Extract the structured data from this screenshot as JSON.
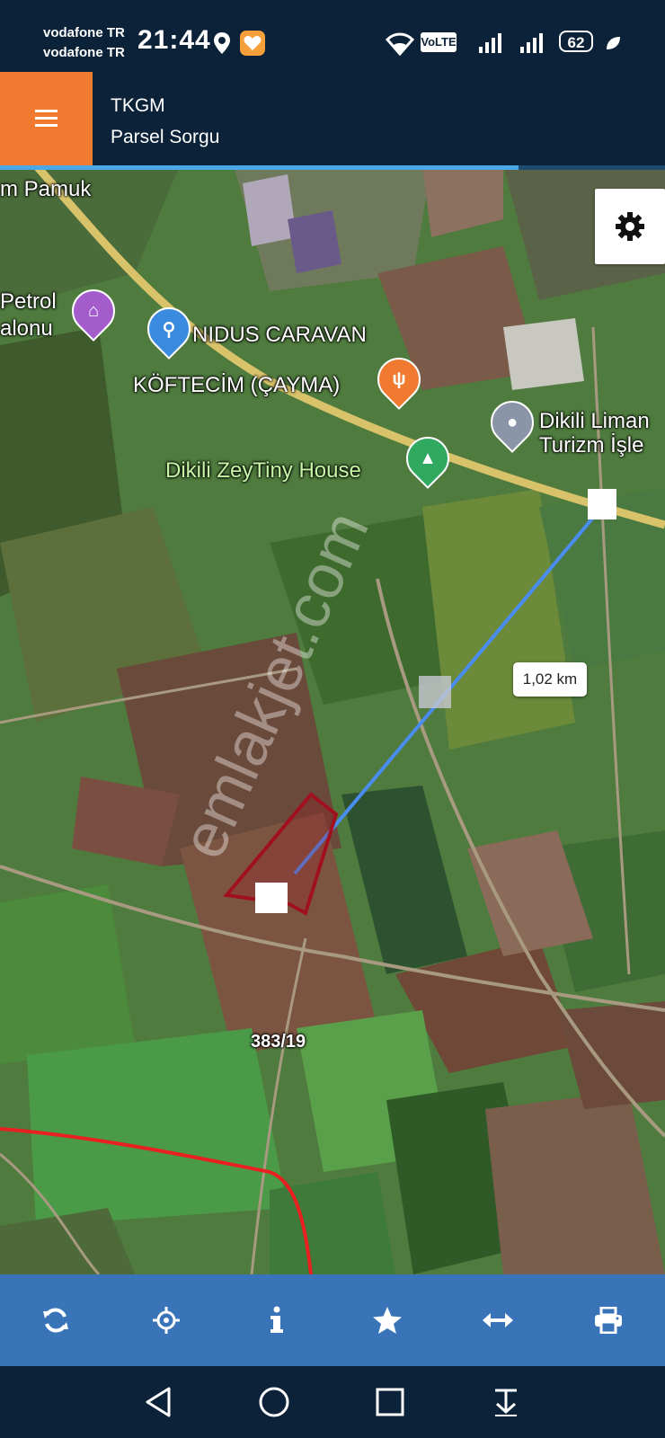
{
  "status_bar": {
    "carrier1": "vodafone TR",
    "carrier2": "vodafone TR",
    "time": "21:44",
    "volte": "VoLTE",
    "battery": "62"
  },
  "app": {
    "title_line1": "TKGM",
    "title_line2": "Parsel Sorgu",
    "load_progress": 0.78
  },
  "map": {
    "place_labels": [
      {
        "text": "m Pamuk"
      },
      {
        "text": "Petrol"
      },
      {
        "text": "alonu"
      },
      {
        "text": "NIDUS CARAVAN"
      },
      {
        "text": "KÖFTECİM (ÇAYMA)"
      },
      {
        "text": "Dikili Liman"
      },
      {
        "text": "Turizm İşle"
      },
      {
        "text": "Dikili ZeyTiny House"
      }
    ],
    "distance_label": "1,02 km",
    "parcel_label": "383/19",
    "watermark": "emlakjet.com"
  },
  "toolbar": {
    "buttons": [
      "refresh-icon",
      "locate-icon",
      "info-icon",
      "star-icon",
      "measure-icon",
      "print-icon"
    ]
  },
  "navbar": {
    "buttons": [
      "back-icon",
      "home-icon",
      "recents-icon",
      "notification-pull-icon"
    ]
  },
  "colors": {
    "app_bar": "#0b2238",
    "menu_accent": "#f07a30",
    "toolbar": "#3a74b8",
    "measure_line": "#4a8cf0",
    "parcel_border": "#a0101e",
    "boundary_line": "#e82020"
  }
}
